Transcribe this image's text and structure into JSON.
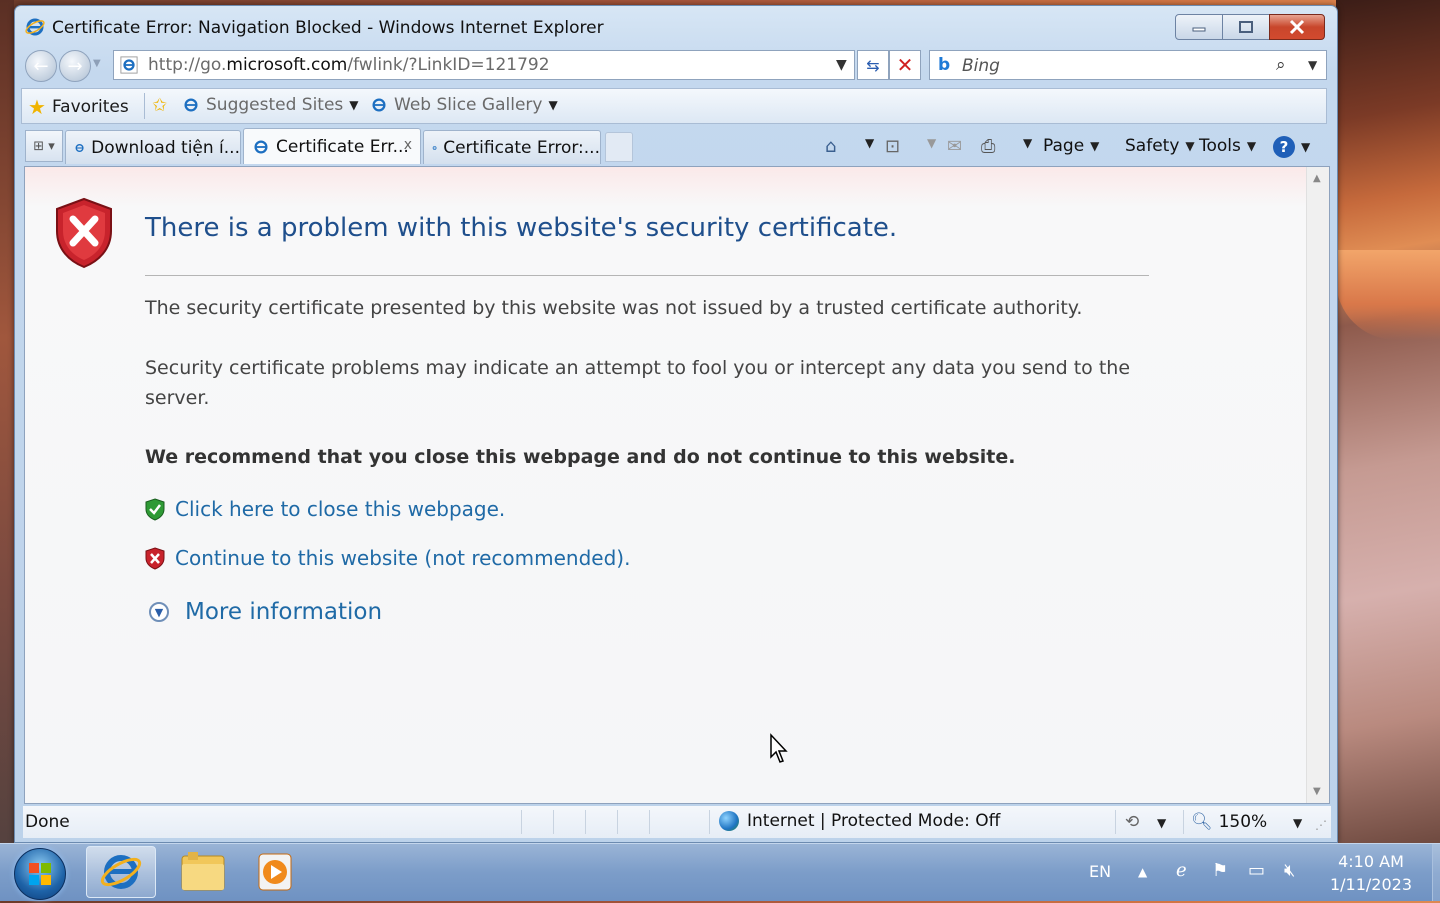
{
  "window": {
    "title": "Certificate Error: Navigation Blocked - Windows Internet Explorer"
  },
  "address": {
    "url_prefix": "http://go.",
    "url_domain": "microsoft.com",
    "url_path": "/fwlink/?LinkID=121792"
  },
  "search": {
    "provider": "b",
    "placeholder": "Bing"
  },
  "favorites": {
    "favorites_label": "Favorites",
    "suggested_label": "Suggested Sites",
    "webslice_label": "Web Slice Gallery"
  },
  "tabs": [
    {
      "label": "Download tiện í..."
    },
    {
      "label": "Certificate Err...",
      "close": "x"
    },
    {
      "label": "Certificate Error:..."
    }
  ],
  "commandbar": {
    "page": "Page",
    "safety": "Safety",
    "tools": "Tools",
    "help": "?"
  },
  "page": {
    "headline": "There is a problem with this website's security certificate.",
    "para1": "The security certificate presented by this website was not issued by a trusted certificate authority.",
    "para2": "Security certificate problems may indicate an attempt to fool you or intercept any data you send to the server.",
    "warning": "We recommend that you close this webpage and do not continue to this website.",
    "close_link": "Click here to close this webpage.",
    "continue_link": "Continue to this website (not recommended).",
    "more_info": "More information"
  },
  "status": {
    "done": "Done",
    "zone": "Internet | Protected Mode: Off",
    "zoom": "150%"
  },
  "taskbar": {
    "language": "EN",
    "time": "4:10 AM",
    "date": "1/11/2023"
  },
  "colors": {
    "link": "#1f6aa6",
    "headline": "#1f4f8c",
    "shield_red": "#c8232c",
    "shield_green": "#2e9a35"
  }
}
